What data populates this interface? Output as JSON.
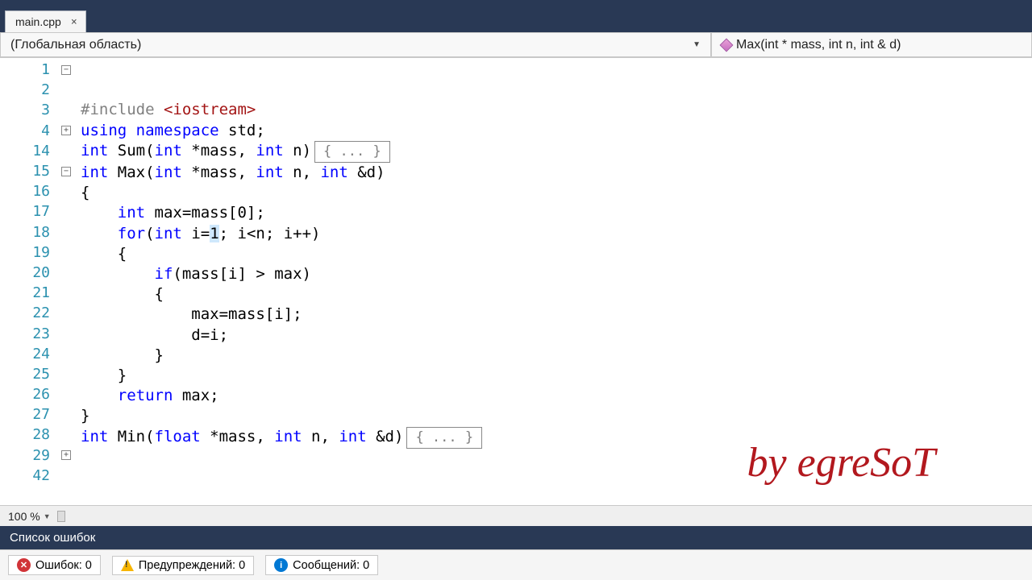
{
  "tab": {
    "filename": "main.cpp"
  },
  "scope": {
    "left": "(Глобальная область)",
    "right": "Max(int * mass, int n, int & d)"
  },
  "code": {
    "lines": [
      {
        "n": 1,
        "fold": "minus",
        "tokens": [
          [
            "pp",
            "#include "
          ],
          [
            "str",
            "<iostream>"
          ]
        ]
      },
      {
        "n": 2,
        "fold": "line",
        "tokens": [
          [
            "kw",
            "using "
          ],
          [
            "kw",
            "namespace"
          ],
          [
            "",
            " std;"
          ]
        ]
      },
      {
        "n": 3,
        "fold": "line",
        "tokens": [
          [
            "",
            ""
          ]
        ]
      },
      {
        "n": 4,
        "fold": "plus",
        "tokens": [
          [
            "kw",
            "int"
          ],
          [
            "",
            " Sum("
          ],
          [
            "kw",
            "int"
          ],
          [
            "",
            " *mass, "
          ],
          [
            "kw",
            "int"
          ],
          [
            "",
            " n)"
          ]
        ],
        "collapsed": "{ ... }"
      },
      {
        "n": 14,
        "fold": "",
        "tokens": [
          [
            "",
            ""
          ]
        ]
      },
      {
        "n": 15,
        "fold": "minus",
        "tokens": [
          [
            "kw",
            "int"
          ],
          [
            "",
            " Max("
          ],
          [
            "kw",
            "int"
          ],
          [
            "",
            " *mass, "
          ],
          [
            "kw",
            "int"
          ],
          [
            "",
            " n, "
          ],
          [
            "kw",
            "int"
          ],
          [
            "",
            " &d)"
          ]
        ]
      },
      {
        "n": 16,
        "fold": "line",
        "tokens": [
          [
            "",
            "{"
          ]
        ]
      },
      {
        "n": 17,
        "fold": "line",
        "tokens": [
          [
            "",
            "    "
          ],
          [
            "kw",
            "int"
          ],
          [
            "",
            " max=mass[0];"
          ]
        ]
      },
      {
        "n": 18,
        "fold": "line",
        "tokens": [
          [
            "",
            "    "
          ],
          [
            "kw",
            "for"
          ],
          [
            "",
            "("
          ],
          [
            "kw",
            "int"
          ],
          [
            "",
            " i="
          ],
          [
            "hl",
            "1"
          ],
          [
            "",
            "; i<n; i++)"
          ]
        ]
      },
      {
        "n": 19,
        "fold": "line",
        "tokens": [
          [
            "",
            "    {"
          ]
        ]
      },
      {
        "n": 20,
        "fold": "line",
        "tokens": [
          [
            "",
            "        "
          ],
          [
            "kw",
            "if"
          ],
          [
            "",
            "(mass[i] > max)"
          ]
        ]
      },
      {
        "n": 21,
        "fold": "line",
        "tokens": [
          [
            "",
            "        {"
          ]
        ]
      },
      {
        "n": 22,
        "fold": "line",
        "tokens": [
          [
            "",
            "            max=mass[i];"
          ]
        ]
      },
      {
        "n": 23,
        "fold": "line",
        "tokens": [
          [
            "",
            "            d=i;"
          ]
        ]
      },
      {
        "n": 24,
        "fold": "line",
        "tokens": [
          [
            "",
            "        }"
          ]
        ]
      },
      {
        "n": 25,
        "fold": "line",
        "tokens": [
          [
            "",
            "    }"
          ]
        ]
      },
      {
        "n": 26,
        "fold": "line",
        "tokens": [
          [
            "",
            "    "
          ],
          [
            "kw",
            "return"
          ],
          [
            "",
            " max;"
          ]
        ]
      },
      {
        "n": 27,
        "fold": "line",
        "tokens": [
          [
            "",
            "}"
          ]
        ]
      },
      {
        "n": 28,
        "fold": "",
        "tokens": [
          [
            "",
            ""
          ]
        ]
      },
      {
        "n": 29,
        "fold": "plus",
        "tokens": [
          [
            "kw",
            "int"
          ],
          [
            "",
            " Min("
          ],
          [
            "kw",
            "float"
          ],
          [
            "",
            " *mass, "
          ],
          [
            "kw",
            "int"
          ],
          [
            "",
            " n, "
          ],
          [
            "kw",
            "int"
          ],
          [
            "",
            " &d)"
          ]
        ],
        "collapsed": "{ ... }"
      },
      {
        "n": 42,
        "fold": "",
        "tokens": [
          [
            "",
            ""
          ]
        ]
      }
    ]
  },
  "zoom": "100 %",
  "error_list": {
    "title": "Список ошибок",
    "errors": "Ошибок: 0",
    "warnings": "Предупреждений: 0",
    "messages": "Сообщений: 0"
  },
  "watermark": "by egreSoT"
}
